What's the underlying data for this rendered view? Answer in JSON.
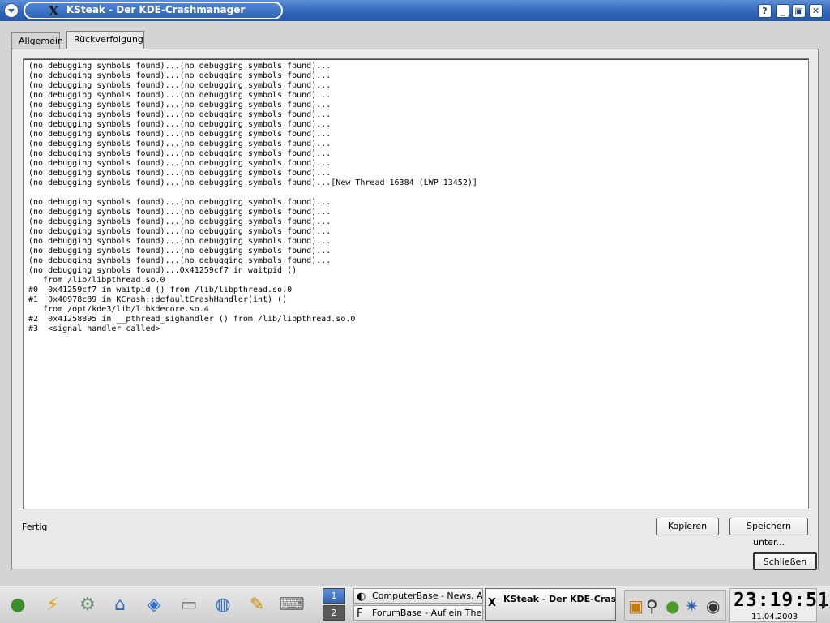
{
  "window": {
    "title": "KSteak - Der KDE-Crashmanager",
    "controls": {
      "help": "?",
      "minimize": "_",
      "maximize": "▣",
      "close": "✕"
    }
  },
  "tabs": [
    {
      "label": "Allgemein",
      "active": false
    },
    {
      "label": "Rückverfolgung",
      "active": true
    }
  ],
  "backtrace": {
    "text": "(no debugging symbols found)...(no debugging symbols found)...\n(no debugging symbols found)...(no debugging symbols found)...\n(no debugging symbols found)...(no debugging symbols found)...\n(no debugging symbols found)...(no debugging symbols found)...\n(no debugging symbols found)...(no debugging symbols found)...\n(no debugging symbols found)...(no debugging symbols found)...\n(no debugging symbols found)...(no debugging symbols found)...\n(no debugging symbols found)...(no debugging symbols found)...\n(no debugging symbols found)...(no debugging symbols found)...\n(no debugging symbols found)...(no debugging symbols found)...\n(no debugging symbols found)...(no debugging symbols found)...\n(no debugging symbols found)...(no debugging symbols found)...\n(no debugging symbols found)...(no debugging symbols found)...[New Thread 16384 (LWP 13452)]\n\n(no debugging symbols found)...(no debugging symbols found)...\n(no debugging symbols found)...(no debugging symbols found)...\n(no debugging symbols found)...(no debugging symbols found)...\n(no debugging symbols found)...(no debugging symbols found)...\n(no debugging symbols found)...(no debugging symbols found)...\n(no debugging symbols found)...(no debugging symbols found)...\n(no debugging symbols found)...(no debugging symbols found)...\n(no debugging symbols found)...0x41259cf7 in waitpid ()\n   from /lib/libpthread.so.0\n#0  0x41259cf7 in waitpid () from /lib/libpthread.so.0\n#1  0x40978c89 in KCrash::defaultCrashHandler(int) ()\n   from /opt/kde3/lib/libkdecore.so.4\n#2  0x41258895 in __pthread_sighandler () from /lib/libpthread.so.0\n#3  <signal handler called>"
  },
  "status": "Fertig",
  "buttons": {
    "copy": "Kopieren",
    "save_as": "Speichern unter...",
    "close": "Schließen"
  },
  "taskbar": {
    "pager": [
      "1",
      "2"
    ],
    "tasks": [
      {
        "label": "ComputerBase - News, Artik",
        "icon": "browser-icon"
      },
      {
        "label": "ForumBase - Auf ein Thema",
        "icon": "forum-icon"
      },
      {
        "label": "KSteak - Der KDE-Crashma",
        "icon": "x-icon",
        "active": true
      }
    ],
    "clock": {
      "time": "23:19:51",
      "date": "11.04.2003"
    }
  }
}
